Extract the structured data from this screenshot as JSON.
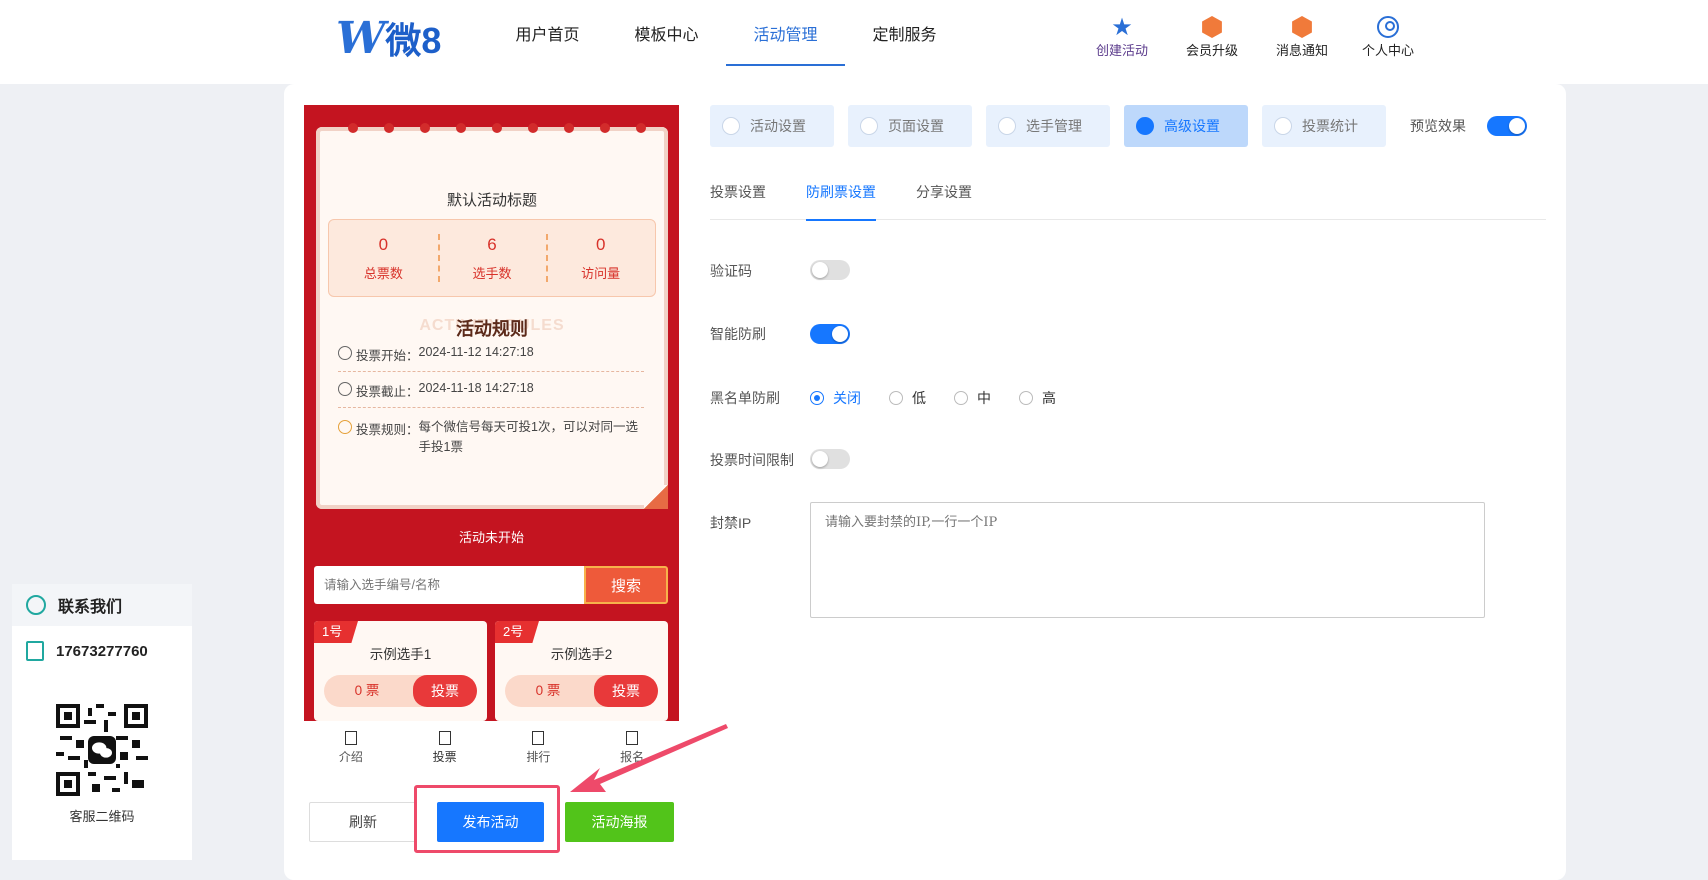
{
  "brand": {
    "logo_mark": "W",
    "logo_text": "微8"
  },
  "nav": {
    "items": [
      {
        "label": "用户首页",
        "active": false
      },
      {
        "label": "模板中心",
        "active": false
      },
      {
        "label": "活动管理",
        "active": true
      },
      {
        "label": "定制服务",
        "active": false
      }
    ]
  },
  "quick": {
    "create": "创建活动",
    "upgrade": "会员升级",
    "notice": "消息通知",
    "center": "个人中心"
  },
  "preview": {
    "title": "默认活动标题",
    "stats": [
      {
        "num": "0",
        "label": "总票数"
      },
      {
        "num": "6",
        "label": "选手数"
      },
      {
        "num": "0",
        "label": "访问量"
      }
    ],
    "rules_title": "活动规则",
    "rules_bg": "ACTIVITY RULES",
    "start_label": "投票开始：",
    "start_time": "2024-11-12 14:27:18",
    "end_label": "投票截止：",
    "end_time": "2024-11-18 14:27:18",
    "rule_label": "投票规则：",
    "rule_text": "每个微信号每天可投1次，可以对同一选手投1票",
    "status": "活动未开始",
    "search_placeholder": "请输入选手编号/名称",
    "search_button": "搜索",
    "players": [
      {
        "tag": "1号",
        "name": "示例选手1",
        "votes": "0 票",
        "vote_button": "投票"
      },
      {
        "tag": "2号",
        "name": "示例选手2",
        "votes": "0 票",
        "vote_button": "投票"
      }
    ],
    "tabbar": [
      "介绍",
      "投票",
      "排行",
      "报名"
    ]
  },
  "actions": {
    "refresh": "刷新",
    "publish": "发布活动",
    "poster": "活动海报"
  },
  "settings": {
    "top_tabs": [
      {
        "label": "活动设置",
        "active": false
      },
      {
        "label": "页面设置",
        "active": false
      },
      {
        "label": "选手管理",
        "active": false
      },
      {
        "label": "高级设置",
        "active": true
      },
      {
        "label": "投票统计",
        "active": false
      }
    ],
    "preview_label": "预览效果",
    "preview_on": true,
    "sub_tabs": [
      {
        "label": "投票设置",
        "active": false
      },
      {
        "label": "防刷票设置",
        "active": true
      },
      {
        "label": "分享设置",
        "active": false
      }
    ],
    "captcha_label": "验证码",
    "captcha_on": false,
    "smart_label": "智能防刷",
    "smart_on": true,
    "blacklist_label": "黑名单防刷",
    "blacklist_options": [
      {
        "label": "关闭",
        "checked": true
      },
      {
        "label": "低",
        "checked": false
      },
      {
        "label": "中",
        "checked": false
      },
      {
        "label": "高",
        "checked": false
      }
    ],
    "timelimit_label": "投票时间限制",
    "timelimit_on": false,
    "ip_label": "封禁IP",
    "ip_placeholder": "请输入要封禁的IP,一行一个IP"
  },
  "contact": {
    "title": "联系我们",
    "phone": "17673277760",
    "qr_label": "客服二维码"
  }
}
